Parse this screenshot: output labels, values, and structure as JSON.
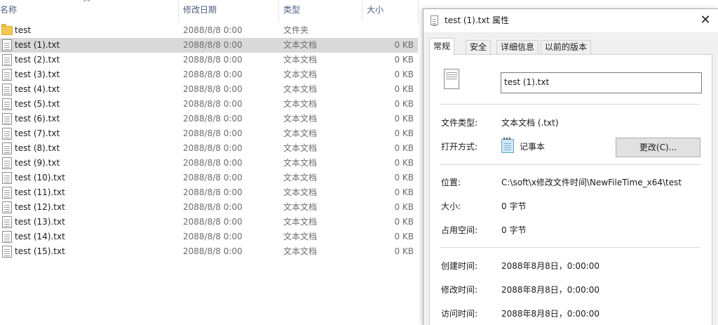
{
  "explorer": {
    "columns": {
      "name": "名称",
      "date": "修改日期",
      "type": "类型",
      "size": "大小"
    },
    "rows": [
      {
        "name": "test",
        "date": "2088/8/8 0:00",
        "type": "文件夹",
        "size": "",
        "icon": "folder-icon"
      },
      {
        "name": "test (1).txt",
        "date": "2088/8/8 0:00",
        "type": "文本文档",
        "size": "0 KB",
        "icon": "text-file-icon",
        "selected": true
      },
      {
        "name": "test (2).txt",
        "date": "2088/8/8 0:00",
        "type": "文本文档",
        "size": "0 KB",
        "icon": "text-file-icon"
      },
      {
        "name": "test (3).txt",
        "date": "2088/8/8 0:00",
        "type": "文本文档",
        "size": "0 KB",
        "icon": "text-file-icon"
      },
      {
        "name": "test (4).txt",
        "date": "2088/8/8 0:00",
        "type": "文本文档",
        "size": "0 KB",
        "icon": "text-file-icon"
      },
      {
        "name": "test (5).txt",
        "date": "2088/8/8 0:00",
        "type": "文本文档",
        "size": "0 KB",
        "icon": "text-file-icon"
      },
      {
        "name": "test (6).txt",
        "date": "2088/8/8 0:00",
        "type": "文本文档",
        "size": "0 KB",
        "icon": "text-file-icon"
      },
      {
        "name": "test (7).txt",
        "date": "2088/8/8 0:00",
        "type": "文本文档",
        "size": "0 KB",
        "icon": "text-file-icon"
      },
      {
        "name": "test (8).txt",
        "date": "2088/8/8 0:00",
        "type": "文本文档",
        "size": "0 KB",
        "icon": "text-file-icon"
      },
      {
        "name": "test (9).txt",
        "date": "2088/8/8 0:00",
        "type": "文本文档",
        "size": "0 KB",
        "icon": "text-file-icon"
      },
      {
        "name": "test (10).txt",
        "date": "2088/8/8 0:00",
        "type": "文本文档",
        "size": "0 KB",
        "icon": "text-file-icon"
      },
      {
        "name": "test (11).txt",
        "date": "2088/8/8 0:00",
        "type": "文本文档",
        "size": "0 KB",
        "icon": "text-file-icon"
      },
      {
        "name": "test (12).txt",
        "date": "2088/8/8 0:00",
        "type": "文本文档",
        "size": "0 KB",
        "icon": "text-file-icon"
      },
      {
        "name": "test (13).txt",
        "date": "2088/8/8 0:00",
        "type": "文本文档",
        "size": "0 KB",
        "icon": "text-file-icon"
      },
      {
        "name": "test (14).txt",
        "date": "2088/8/8 0:00",
        "type": "文本文档",
        "size": "0 KB",
        "icon": "text-file-icon"
      },
      {
        "name": "test (15).txt",
        "date": "2088/8/8 0:00",
        "type": "文本文档",
        "size": "0 KB",
        "icon": "text-file-icon"
      }
    ],
    "selection_color": "#d9d9d9"
  },
  "dialog": {
    "title": "test (1).txt 属性",
    "close_glyph": "✕",
    "tabs": [
      {
        "label": "常规",
        "active": true
      },
      {
        "label": "安全"
      },
      {
        "label": "详细信息"
      },
      {
        "label": "以前的版本"
      }
    ],
    "filename": "test (1).txt",
    "file_type_label": "文件类型:",
    "file_type_value": "文本文档 (.txt)",
    "open_with_label": "打开方式:",
    "open_with_value": "记事本",
    "change_button": "更改(C)...",
    "location_label": "位置:",
    "location_value": "C:\\soft\\x修改文件时间\\NewFileTime_x64\\test",
    "size_label": "大小:",
    "size_value": "0 字节",
    "disk_size_label": "占用空间:",
    "disk_size_value": "0 字节",
    "created_label": "创建时间:",
    "created_value": "2088年8月8日，0:00:00",
    "modified_label": "修改时间:",
    "modified_value": "2088年8月8日，0:00:00",
    "accessed_label": "访问时间:",
    "accessed_value": "2088年8月8日，0:00:00"
  }
}
